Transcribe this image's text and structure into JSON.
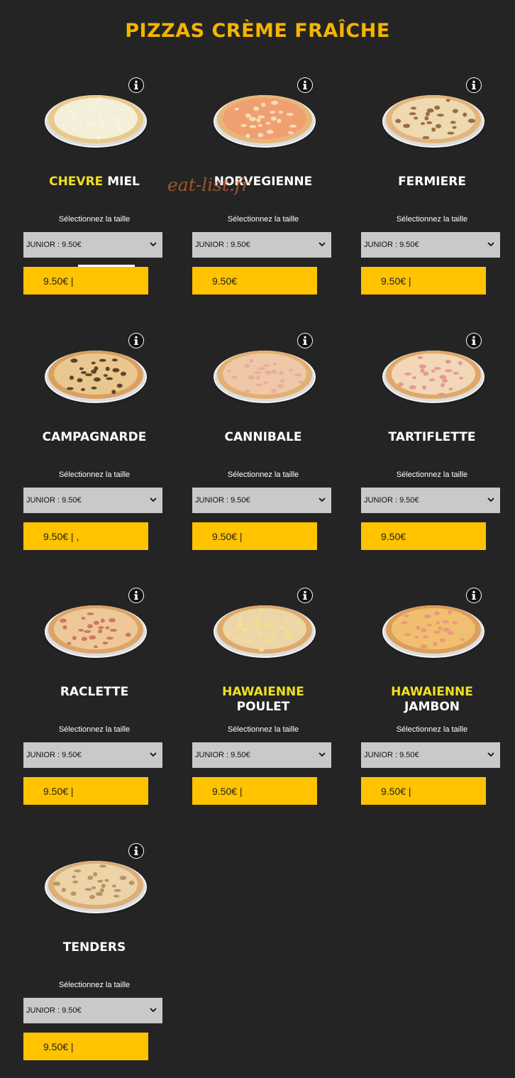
{
  "page": {
    "title": "PIZZAS CRÈME FRAÎCHE",
    "watermark": "eat-list.fr"
  },
  "pizzas": [
    {
      "name_hl": "CHEVRE",
      "name_rest": " MIEL",
      "size_label": "Sélectionnez la taille",
      "selected_size": "JUNIOR : 9.50€",
      "price": "9.50€ |",
      "crust": "#e9c98a",
      "topping": "#f4efd8",
      "dots": "#f7f2e4"
    },
    {
      "name_hl": "",
      "name_rest": "NORVEGIENNE",
      "size_label": "Sélectionnez la taille",
      "selected_size": "JUNIOR : 9.50€",
      "price": "9.50€",
      "crust": "#e7b67a",
      "topping": "#f0a070",
      "dots": "#f6e8c8"
    },
    {
      "name_hl": "",
      "name_rest": "FERMIERE",
      "size_label": "Sélectionnez la taille",
      "selected_size": "JUNIOR : 9.50€",
      "price": "9.50€ |",
      "crust": "#e2b57c",
      "topping": "#efd9b0",
      "dots": "#8a5a2e"
    },
    {
      "name_hl": "",
      "name_rest": "CAMPAGNARDE",
      "size_label": "Sélectionnez la taille",
      "selected_size": "JUNIOR : 9.50€",
      "price": "9.50€ | ,",
      "crust": "#d9a060",
      "topping": "#e9c890",
      "dots": "#4a2c18"
    },
    {
      "name_hl": "",
      "name_rest": "CANNIBALE",
      "size_label": "Sélectionnez la taille",
      "selected_size": "JUNIOR : 9.50€",
      "price": "9.50€ |",
      "crust": "#e2b070",
      "topping": "#f0c8a8",
      "dots": "#e8a89c"
    },
    {
      "name_hl": "",
      "name_rest": "TARTIFLETTE",
      "size_label": "Sélectionnez la taille",
      "selected_size": "JUNIOR : 9.50€",
      "price": "9.50€",
      "crust": "#e0a868",
      "topping": "#f2d8b8",
      "dots": "#e09088"
    },
    {
      "name_hl": "",
      "name_rest": "RACLETTE",
      "size_label": "Sélectionnez la taille",
      "selected_size": "JUNIOR : 9.50€",
      "price": "9.50€ |",
      "crust": "#dca468",
      "topping": "#efc89a",
      "dots": "#c86a58"
    },
    {
      "name_hl": "HAWAIENNE",
      "name_rest": "POULET",
      "size_label": "Sélectionnez la taille",
      "selected_size": "JUNIOR : 9.50€",
      "price": "9.50€ |",
      "crust": "#deaa6c",
      "topping": "#ecd6a8",
      "dots": "#f4e08a"
    },
    {
      "name_hl": "HAWAIENNE",
      "name_rest": "JAMBON",
      "size_label": "Sélectionnez la taille",
      "selected_size": "JUNIOR : 9.50€",
      "price": "9.50€ |",
      "crust": "#dc9e5c",
      "topping": "#f0c070",
      "dots": "#e89080"
    },
    {
      "name_hl": "",
      "name_rest": "TENDERS",
      "size_label": "Sélectionnez la taille",
      "selected_size": "JUNIOR : 9.50€",
      "price": "9.50€ |",
      "crust": "#dcae78",
      "topping": "#ecd4a8",
      "dots": "#b08858"
    }
  ],
  "colors": {
    "background": "#242424",
    "title": "#f5b400",
    "highlight": "#f0e020",
    "price_button": "#ffc300",
    "select_bg": "#c9c9c9"
  },
  "icons": {
    "info": "info-icon",
    "chevron": "chevron-down-icon"
  }
}
